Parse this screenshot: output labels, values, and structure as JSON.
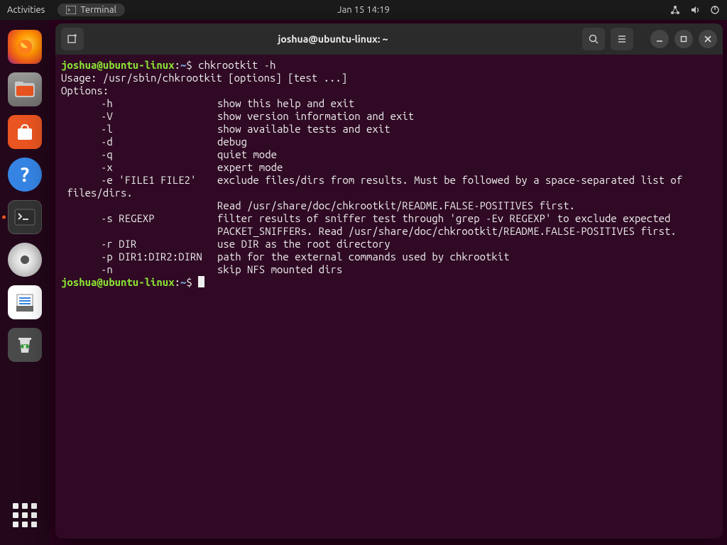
{
  "topbar": {
    "activities": "Activities",
    "appmenu": "Terminal",
    "clock": "Jan 15  14:19"
  },
  "dock": {
    "firefox": "firefox",
    "files": "files",
    "software": "software",
    "help": "help",
    "terminal": "terminal",
    "disc": "disc",
    "texteditor": "text-editor",
    "trash": "trash"
  },
  "window": {
    "title": "joshua@ubuntu-linux: ~"
  },
  "prompt": {
    "userhost": "joshua@ubuntu-linux",
    "colon": ":",
    "path": "~",
    "sigil": "$"
  },
  "cmd1": "chkrootkit -h",
  "usage": "Usage: /usr/sbin/chkrootkit [options] [test ...]",
  "opts_hdr": "Options:",
  "opts": [
    {
      "flag": "-h",
      "desc": "show this help and exit"
    },
    {
      "flag": "-V",
      "desc": "show version information and exit"
    },
    {
      "flag": "-l",
      "desc": "show available tests and exit"
    },
    {
      "flag": "-d",
      "desc": "debug"
    },
    {
      "flag": "-q",
      "desc": "quiet mode"
    },
    {
      "flag": "-x",
      "desc": "expert mode"
    },
    {
      "flag": "-e 'FILE1 FILE2'",
      "desc": "exclude files/dirs from results. Must be followed by a space-separated list of"
    }
  ],
  "cont1": " files/dirs.",
  "cont2": "Read /usr/share/doc/chkrootkit/README.FALSE-POSITIVES first.",
  "opts2": [
    {
      "flag": "-s REGEXP",
      "desc": "filter results of sniffer test through 'grep -Ev REGEXP' to exclude expected"
    }
  ],
  "cont3": "PACKET_SNIFFERs. Read /usr/share/doc/chkrootkit/README.FALSE-POSITIVES first.",
  "opts3": [
    {
      "flag": "-r DIR",
      "desc": "use DIR as the root directory"
    },
    {
      "flag": "-p DIR1:DIR2:DIRN",
      "desc": "path for the external commands used by chkrootkit"
    },
    {
      "flag": "-n",
      "desc": "skip NFS mounted dirs"
    }
  ]
}
